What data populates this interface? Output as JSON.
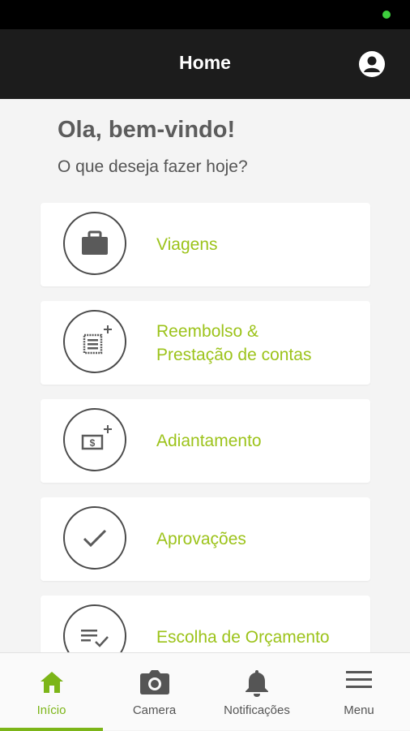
{
  "app_bar": {
    "title": "Home"
  },
  "welcome": {
    "greeting": "Ola, bem-vindo!",
    "subtitle": "O que deseja fazer hoje?"
  },
  "menu_cards": [
    {
      "label": "Viagens",
      "icon": "briefcase-icon"
    },
    {
      "label_line1": "Reembolso &",
      "label_line2": "Prestação de contas",
      "icon": "receipt-add-icon"
    },
    {
      "label": "Adiantamento",
      "icon": "money-add-icon"
    },
    {
      "label": "Aprovações",
      "icon": "checkmark-icon"
    },
    {
      "label": "Escolha de Orçamento",
      "icon": "checklist-icon"
    }
  ],
  "bottom_nav": [
    {
      "label": "Início",
      "icon": "home-icon",
      "active": true
    },
    {
      "label": "Camera",
      "icon": "camera-icon"
    },
    {
      "label": "Notificações",
      "icon": "bell-icon"
    },
    {
      "label": "Menu",
      "icon": "hamburger-icon"
    }
  ],
  "colors": {
    "accent": "#9cc31a",
    "nav_active": "#7cb518",
    "app_bar": "#1c1c1c",
    "background": "#f4f4f4"
  }
}
